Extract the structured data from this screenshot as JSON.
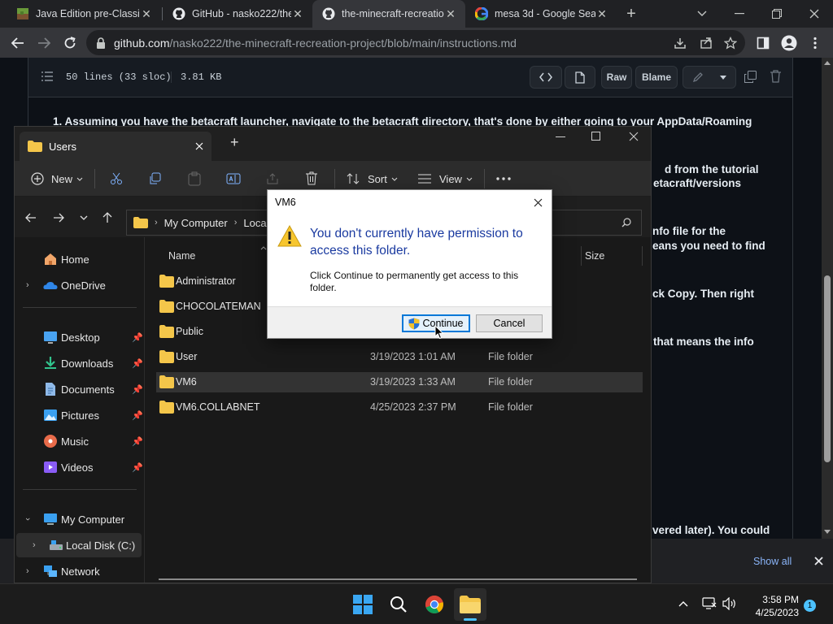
{
  "browser": {
    "tabs": [
      {
        "title": "Java Edition pre-Classic",
        "icon": "minecraft-icon"
      },
      {
        "title": "GitHub - nasko222/the",
        "icon": "github-icon"
      },
      {
        "title": "the-minecraft-recreatio",
        "icon": "github-icon"
      },
      {
        "title": "mesa 3d - Google Sear",
        "icon": "google-icon"
      }
    ],
    "url_host": "github.com",
    "url_path": "/nasko222/the-minecraft-recreation-project/blob/main/instructions.md"
  },
  "github": {
    "file_info": "50 lines (33 sloc)",
    "file_size": "3.81 KB",
    "raw_label": "Raw",
    "blame_label": "Blame",
    "lines": [
      "1. Assuming you have the betacraft launcher, navigate to the betacraft directory, that's done by either going to your AppData/Roaming",
      "d from the tutorial",
      "etacraft/versions",
      "nfo file for the",
      "eans you need to find",
      "ck Copy. Then right",
      "that means the info",
      "vered later). You could"
    ]
  },
  "notification": {
    "show_all": "Show all"
  },
  "explorer": {
    "tab_title": "Users",
    "cmd": {
      "new": "New",
      "sort": "Sort",
      "view": "View"
    },
    "address": {
      "root": "My Computer",
      "current": "Local"
    },
    "columns": {
      "name": "Name",
      "size": "Size"
    },
    "nav": {
      "home": "Home",
      "onedrive": "OneDrive",
      "desktop": "Desktop",
      "downloads": "Downloads",
      "documents": "Documents",
      "pictures": "Pictures",
      "music": "Music",
      "videos": "Videos",
      "my_computer": "My Computer",
      "local_disk": "Local Disk (C:)",
      "network": "Network"
    },
    "files": [
      {
        "name": "Administrator",
        "date": "",
        "type": ""
      },
      {
        "name": "CHOCOLATEMAN",
        "date": "",
        "type": ""
      },
      {
        "name": "Public",
        "date": "",
        "type": ""
      },
      {
        "name": "User",
        "date": "3/19/2023 1:01 AM",
        "type": "File folder"
      },
      {
        "name": "VM6",
        "date": "3/19/2023 1:33 AM",
        "type": "File folder"
      },
      {
        "name": "VM6.COLLABNET",
        "date": "4/25/2023 2:37 PM",
        "type": "File folder"
      }
    ]
  },
  "dialog": {
    "title": "VM6",
    "message": "You don't currently have permission to access this folder.",
    "detail": "Click Continue to permanently get access to this folder.",
    "continue_label": "Continue",
    "cancel_label": "Cancel"
  },
  "taskbar": {
    "time": "3:58 PM",
    "date": "4/25/2023",
    "notification_count": "1"
  }
}
